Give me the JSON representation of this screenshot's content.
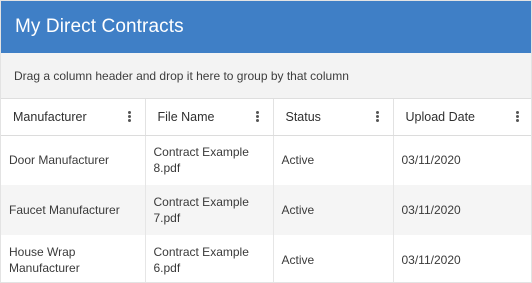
{
  "panel": {
    "title": "My Direct Contracts",
    "group_hint": "Drag a column header and drop it here to group by that column"
  },
  "colors": {
    "header_bg": "#3f7fc6",
    "header_text": "#ffffff",
    "group_bar_bg": "#f3f3f3",
    "alt_row_bg": "#f5f5f5"
  },
  "table": {
    "columns": [
      {
        "label": "Manufacturer",
        "menu_icon": "kebab-menu-icon"
      },
      {
        "label": "File Name",
        "menu_icon": "kebab-menu-icon"
      },
      {
        "label": "Status",
        "menu_icon": "kebab-menu-icon"
      },
      {
        "label": "Upload Date",
        "menu_icon": "kebab-menu-icon"
      }
    ],
    "rows": [
      [
        "Door Manufacturer",
        "Contract Example 8.pdf",
        "Active",
        "03/11/2020"
      ],
      [
        "Faucet Manufacturer",
        "Contract Example 7.pdf",
        "Active",
        "03/11/2020"
      ],
      [
        "House Wrap Manufacturer",
        "Contract Example 6.pdf",
        "Active",
        "03/11/2020"
      ]
    ]
  }
}
